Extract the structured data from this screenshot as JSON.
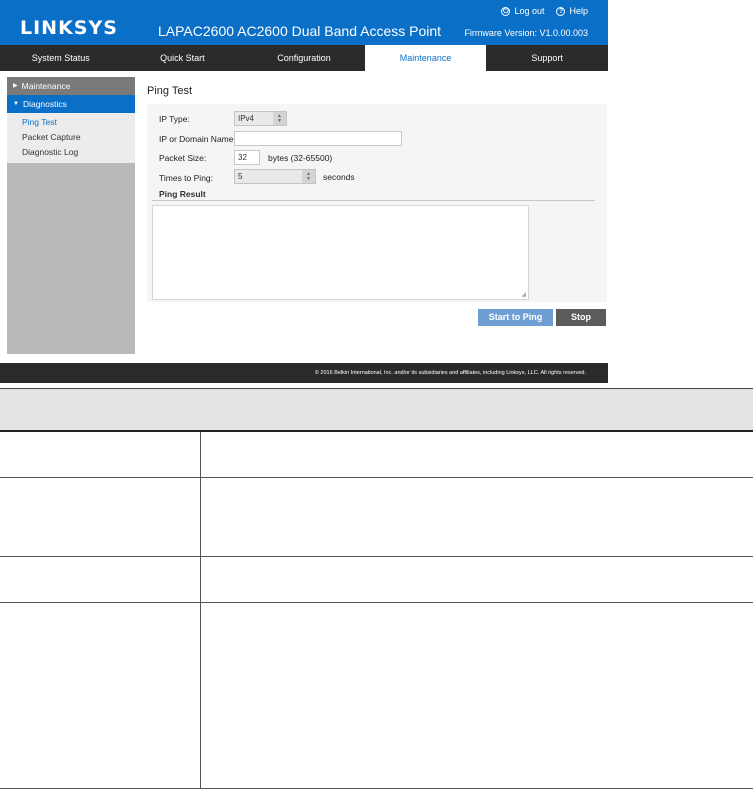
{
  "header": {
    "logo": "LINKSYS",
    "title": "LAPAC2600 AC2600 Dual Band Access Point",
    "logout_label": "Log out",
    "help_label": "Help",
    "firmware": "Firmware Version: V1.0.00.003"
  },
  "nav": {
    "tabs": [
      "System Status",
      "Quick Start",
      "Configuration",
      "Maintenance",
      "Support"
    ],
    "active": "Maintenance"
  },
  "sidebar": {
    "sections": [
      {
        "label": "Maintenance",
        "expanded": false
      },
      {
        "label": "Diagnostics",
        "expanded": true
      }
    ],
    "items": [
      "Ping Test",
      "Packet Capture",
      "Diagnostic Log"
    ],
    "active_item": "Ping Test"
  },
  "ping": {
    "title": "Ping Test",
    "ip_type_label": "IP Type:",
    "ip_type_value": "IPv4",
    "domain_label": "IP or Domain Name:",
    "domain_value": "",
    "packet_size_label": "Packet Size:",
    "packet_size_value": "32",
    "packet_size_hint": "bytes (32-65500)",
    "times_label": "Times to Ping:",
    "times_value": "5",
    "times_unit": "seconds",
    "result_label": "Ping Result",
    "result_value": "",
    "start_button": "Start to Ping",
    "stop_button": "Stop"
  },
  "footer": {
    "copyright": "© 2016 Belkin International, Inc. and/or its subsidiaries and affiliates, including Linksys, LLC. All rights reserved."
  },
  "colors": {
    "brand_blue": "#0a6fc7",
    "nav_dark": "#2b2b2b",
    "start_button": "#6f9fd2",
    "stop_button": "#5b5b5b"
  }
}
